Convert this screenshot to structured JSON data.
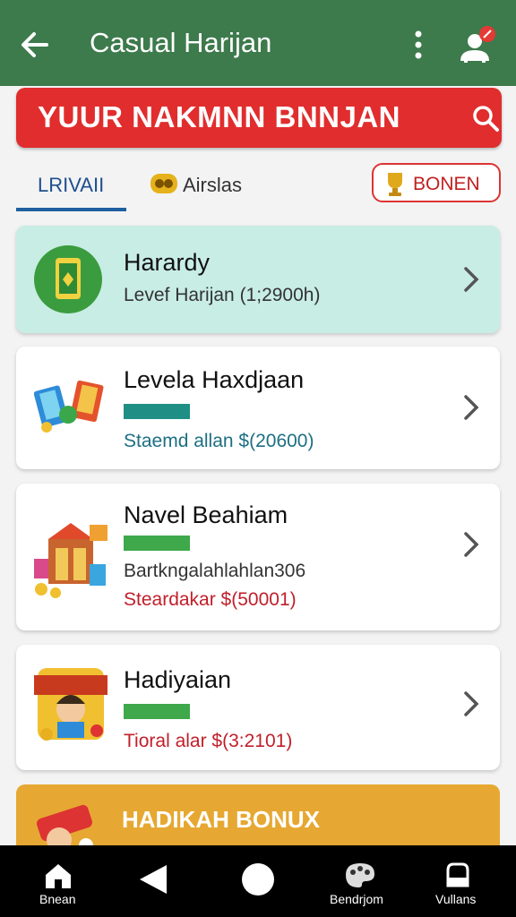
{
  "app": {
    "title": "Casual Harijan"
  },
  "banner": {
    "text": "YUUR NAKMNN BNNJAN"
  },
  "tabs": {
    "tab1": "LRIVAII",
    "tab2": "Airslas",
    "bonus_button": "BONEN"
  },
  "cards": [
    {
      "title": "Harardy",
      "subtitle": "Levef Harijan   (1;2900h)"
    },
    {
      "title": "Levela Haxdjaan",
      "price": "Staemd allan $(20600)"
    },
    {
      "title": "Navel Beahiam",
      "subtitle": "Bartkngalahlahlan306",
      "price": "Steardakar $(50001)"
    },
    {
      "title": "Hadiyaian",
      "price": "Tioral alar $(3:2101)"
    }
  ],
  "bonus_card": {
    "text": "HADIKAH BONUX"
  },
  "navbar": {
    "home": "Bnean",
    "games": "Bendrjom",
    "profile": "Vullans"
  },
  "colors": {
    "appbar": "#3d7a4c",
    "banner": "#e12d2d",
    "card1_bg": "#c8ede4",
    "bar_teal": "#1f8f86",
    "bar_green": "#3ea84a",
    "price_teal": "#1d6f83",
    "price_red": "#c01f2a",
    "bonus": "#e6a832"
  }
}
